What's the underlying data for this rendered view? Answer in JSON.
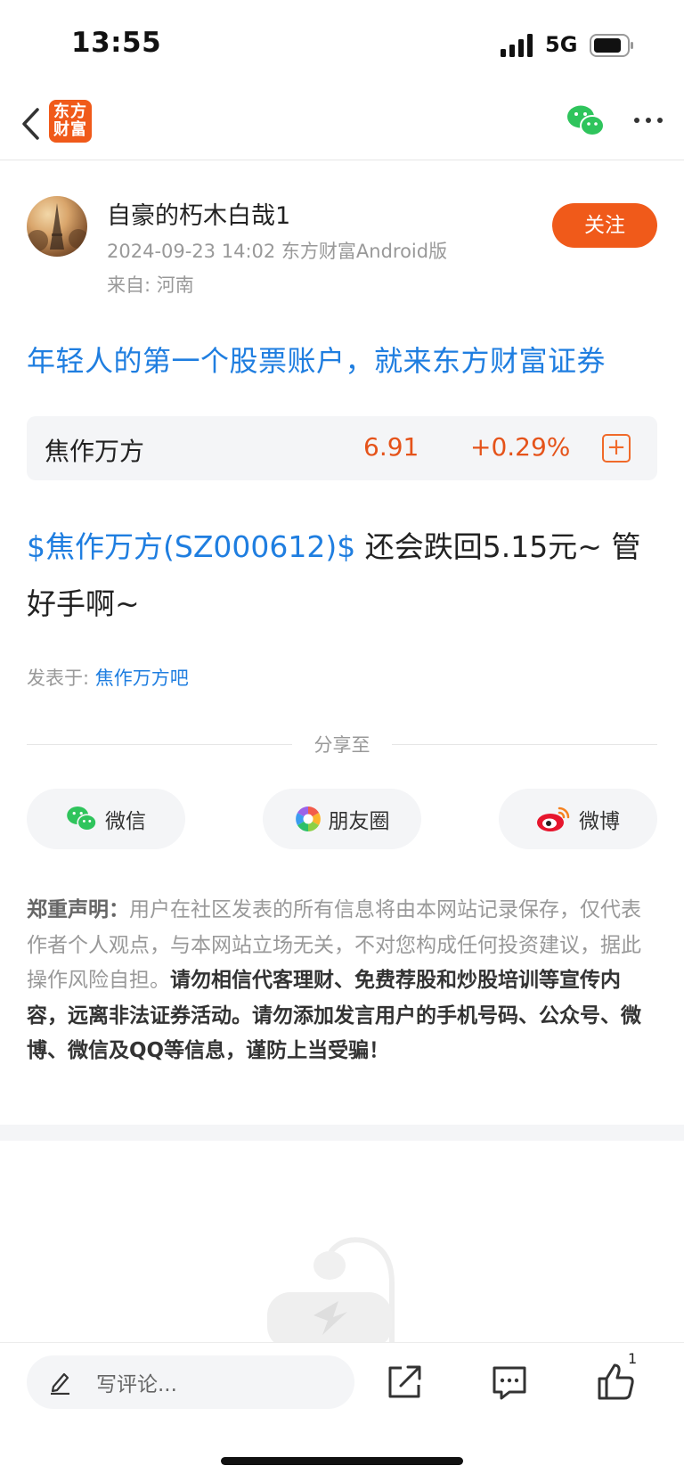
{
  "status_bar": {
    "time": "13:55",
    "network": "5G"
  },
  "nav": {
    "logo_text": "东方财富",
    "icons": [
      "back-arrow-icon",
      "wechat-icon",
      "more-icon"
    ]
  },
  "author": {
    "name": "自豪的朽木白哉1",
    "meta": "2024-09-23 14:02 东方财富Android版",
    "from": "来自: 河南",
    "follow_label": "关注"
  },
  "ad_line": "年轻人的第一个股票账户，就来东方财富证券",
  "stock_card": {
    "name": "焦作万方",
    "price": "6.91",
    "change": "+0.29%",
    "add_symbol": "+"
  },
  "post": {
    "stock_link": "$焦作万方(SZ000612)$",
    "text": " 还会跌回5.15元~ 管好手啊~",
    "posted_in_label": "发表于: ",
    "bar_name": "焦作万方吧"
  },
  "share": {
    "divider_label": "分享至",
    "wechat": "微信",
    "moments": "朋友圈",
    "weibo": "微博"
  },
  "disclaimer": {
    "label": "郑重声明：",
    "normal": "用户在社区发表的所有信息将由本网站记录保存，仅代表作者个人观点，与本网站立场无关，不对您构成任何投资建议，据此操作风险自担。",
    "strong": "请勿相信代客理财、免费荐股和炒股培训等宣传内容，远离非法证券活动。请勿添加发言用户的手机号码、公众号、微博、微信及QQ等信息，谨防上当受骗！"
  },
  "bottom_bar": {
    "comment_placeholder": "写评论...",
    "like_count": "1"
  },
  "colors": {
    "accent_orange": "#f05a1a",
    "link_blue": "#1f7ee0",
    "stock_red": "#e5531a"
  }
}
